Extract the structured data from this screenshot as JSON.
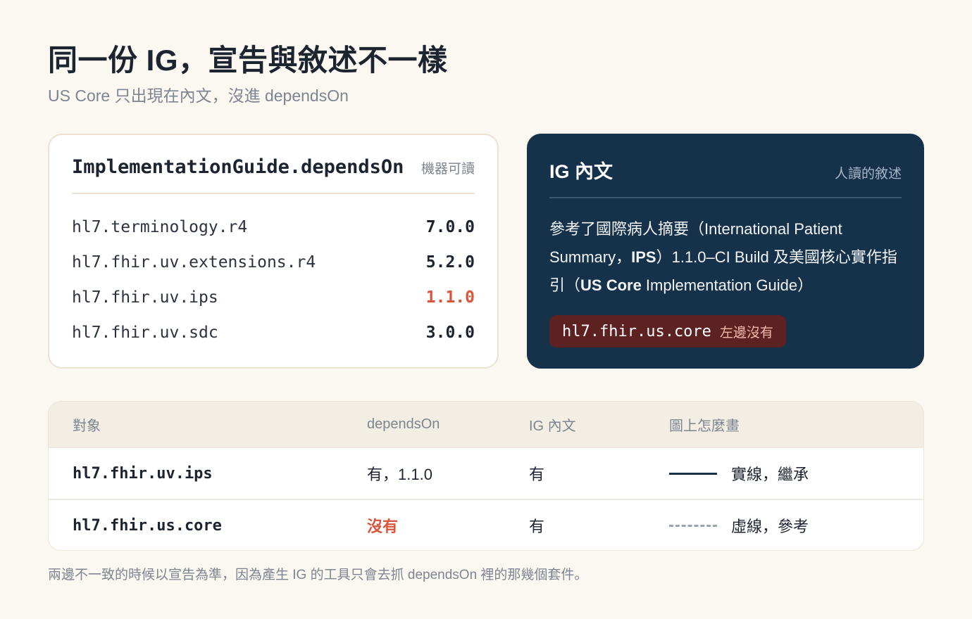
{
  "header": {
    "title": "同一份 IG，宣告與敘述不一樣",
    "subtitle": "US Core 只出現在內文，沒進 dependsOn"
  },
  "depends_card": {
    "title": "ImplementationGuide.dependsOn",
    "note": "機器可讀",
    "items": [
      {
        "package": "hl7.terminology.r4",
        "version": "7.0.0"
      },
      {
        "package": "hl7.fhir.uv.extensions.r4",
        "version": "5.2.0"
      },
      {
        "package": "hl7.fhir.uv.ips",
        "version": "1.1.0"
      },
      {
        "package": "hl7.fhir.uv.sdc",
        "version": "3.0.0"
      }
    ]
  },
  "narrative_card": {
    "title": "IG 內文",
    "note": "人讀的敘述",
    "text_1": "參考了國際病人摘要（International Patient Summary，",
    "text_ips": "IPS",
    "text_2": "）1.1.0–CI Build 及美國核心實作指引（",
    "text_uscore": "US Core",
    "text_3": " Implementation Guide）",
    "missing_code": "hl7.fhir.us.core",
    "missing_note": "左邊沒有"
  },
  "comparison_table": {
    "headers": [
      "對象",
      "dependsOn",
      "IG 內文",
      "圖上怎麼畫"
    ],
    "rows": [
      {
        "target": "hl7.fhir.uv.ips",
        "depends_on": "有，1.1.0",
        "in_narrative": "有",
        "drawing": "實線，繼承"
      },
      {
        "target": "hl7.fhir.us.core",
        "depends_on": "沒有",
        "in_narrative": "有",
        "drawing": "虛線，參考"
      }
    ]
  },
  "footnote": "兩邊不一致的時候以宣告為準，因為產生 IG 的工具只會去抓 dependsOn 裡的那幾個套件。",
  "colors": {
    "background": "#fbf7f1",
    "navy": "#16324b",
    "alert": "#d9563c",
    "missing_tag": "#5e2121"
  }
}
